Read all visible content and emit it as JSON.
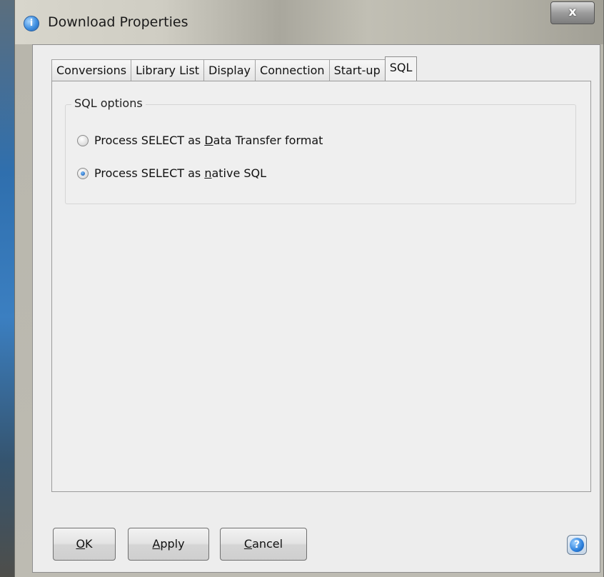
{
  "window": {
    "title": "Download Properties",
    "title_icon_glyph": "i",
    "close_glyph": "x"
  },
  "tabs": [
    {
      "label": "Conversions"
    },
    {
      "label": "Library List"
    },
    {
      "label": "Display"
    },
    {
      "label": "Connection"
    },
    {
      "label": "Start-up"
    },
    {
      "label": "SQL",
      "active": true
    }
  ],
  "sql_options": {
    "group_title": "SQL options",
    "option1": {
      "before": "Process SELECT as ",
      "mnemonic": "D",
      "after": "ata Transfer format",
      "selected": false
    },
    "option2": {
      "before": "Process SELECT as ",
      "mnemonic": "n",
      "after": "ative SQL",
      "selected": true
    }
  },
  "buttons": {
    "ok": {
      "mnemonic": "O",
      "rest": "K"
    },
    "apply": {
      "mnemonic": "A",
      "rest": "pply"
    },
    "cancel": {
      "mnemonic": "C",
      "rest": "ancel"
    }
  },
  "help": {
    "glyph": "?"
  },
  "icons": {
    "title": "info-icon",
    "close": "close-icon",
    "help": "help-icon"
  },
  "colors": {
    "selected_radio": "#1b63b8",
    "dialog_background": "#ededed"
  }
}
